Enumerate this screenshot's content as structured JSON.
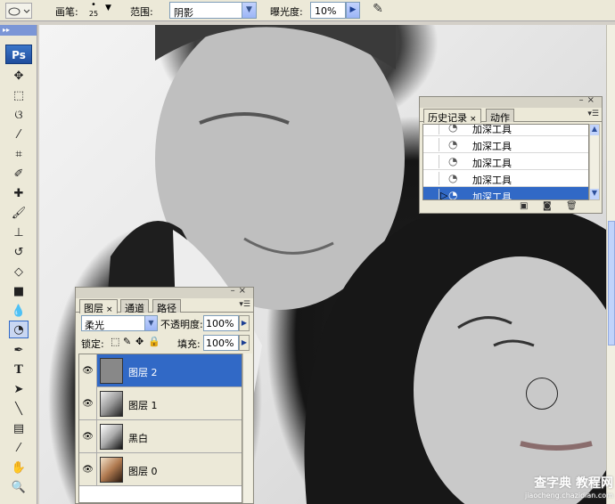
{
  "options_bar": {
    "brush_label": "画笔:",
    "brush_size": "25",
    "range_label": "范围:",
    "range_value": "阴影",
    "exposure_label": "曝光度:",
    "exposure_value": "10%"
  },
  "toolbox": {
    "logo": "Ps",
    "tools": [
      "move-tool",
      "marquee-tool",
      "lasso-tool",
      "magic-wand-tool",
      "crop-tool",
      "slice-tool",
      "healing-brush-tool",
      "brush-tool",
      "clone-stamp-tool",
      "history-brush-tool",
      "eraser-tool",
      "gradient-tool",
      "blur-tool",
      "burn-tool",
      "pen-tool",
      "type-tool",
      "path-selection-tool",
      "line-tool",
      "notes-tool",
      "eyedropper-tool",
      "hand-tool",
      "zoom-tool"
    ],
    "active_tool": "burn-tool"
  },
  "history_panel": {
    "tabs": [
      "历史记录",
      "动作"
    ],
    "items": [
      "加深工具",
      "加深工具",
      "加深工具",
      "加深工具",
      "加深工具"
    ],
    "selected_index": 4
  },
  "layers_panel": {
    "tabs": [
      "图层",
      "通道",
      "路径"
    ],
    "blend_mode": "柔光",
    "opacity_label": "不透明度:",
    "opacity_value": "100%",
    "lock_label": "锁定:",
    "fill_label": "填充:",
    "fill_value": "100%",
    "layers": [
      {
        "name": "图层 2",
        "selected": true
      },
      {
        "name": "图层 1",
        "selected": false
      },
      {
        "name": "黑白",
        "selected": false
      },
      {
        "name": "图层 0",
        "selected": false
      }
    ]
  },
  "watermark": {
    "line1": "查字典 教程网",
    "line2": "jiaocheng.chazidian.com"
  }
}
